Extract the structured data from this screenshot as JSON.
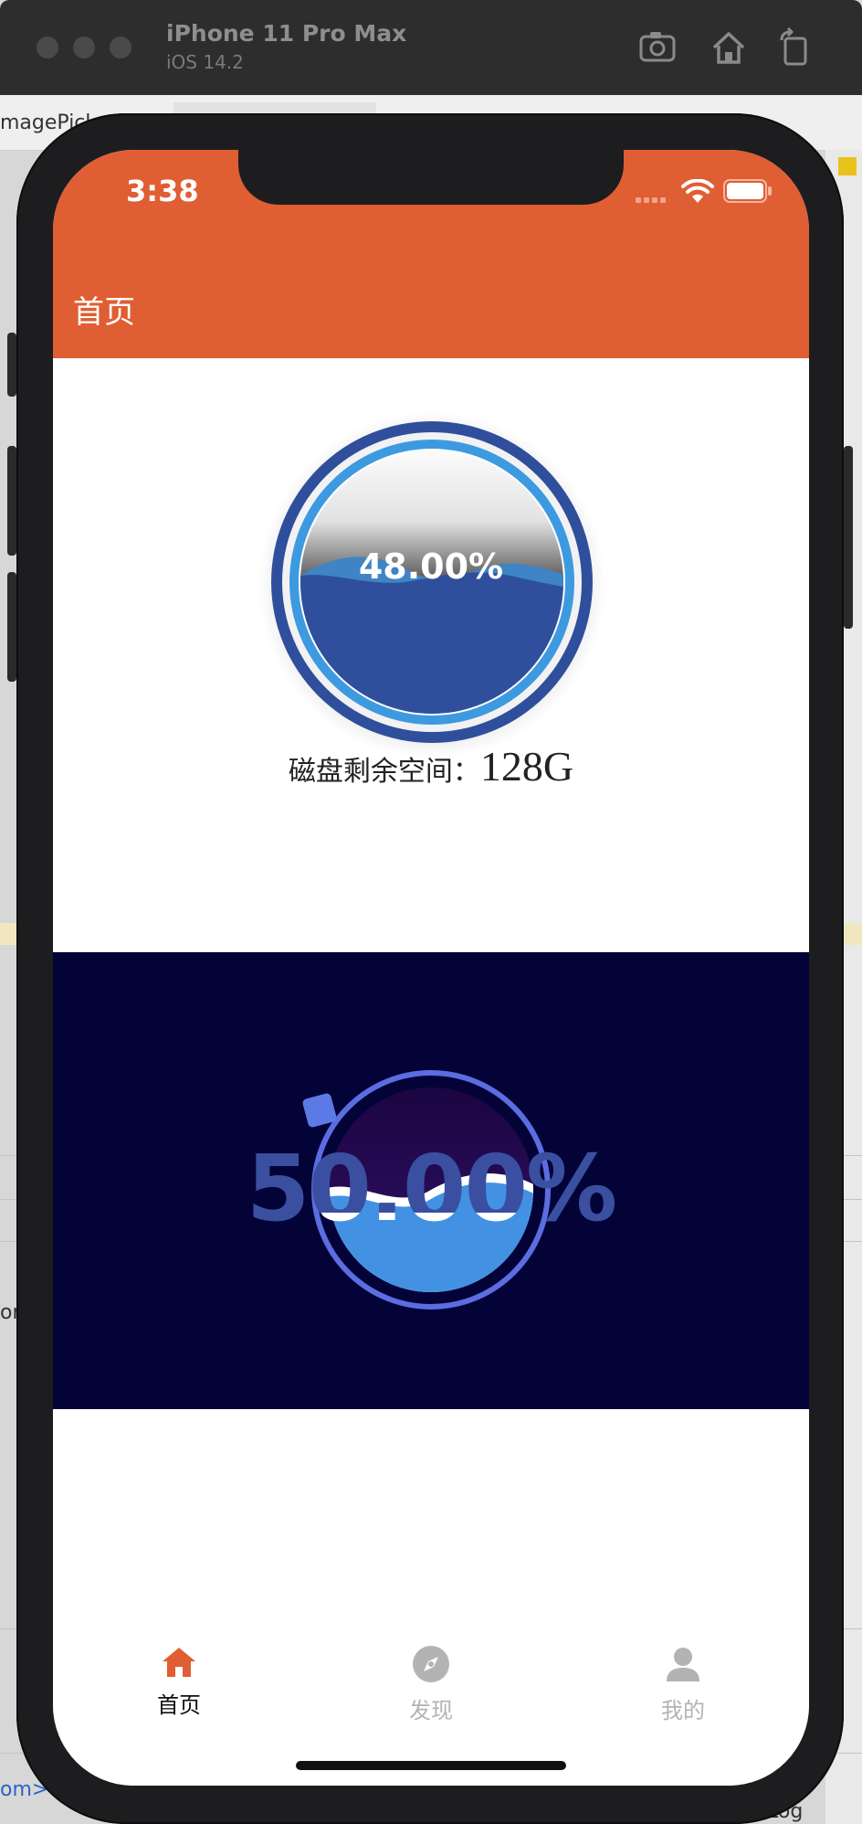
{
  "simulator": {
    "title": "iPhone 11 Pro Max",
    "subtitle": "iOS 14.2",
    "buttons": [
      "screenshot-icon",
      "home-icon",
      "rotate-icon"
    ]
  },
  "background": {
    "tab_text": "magePick",
    "left_text": "or",
    "bottom_left": "om>",
    "bottom_right": "Log"
  },
  "status_bar": {
    "time": "3:38"
  },
  "navbar": {
    "title": "首页"
  },
  "disk_gauge": {
    "percent_text": "48.00%",
    "fill_level": 0.48,
    "label": "磁盘剩余空间：",
    "value": "128G"
  },
  "progress_gauge": {
    "percent_text": "50.00%",
    "fill_level": 0.5
  },
  "tabbar": {
    "items": [
      {
        "label": "首页",
        "icon": "home-icon",
        "active": true
      },
      {
        "label": "发现",
        "icon": "compass-icon",
        "active": false
      },
      {
        "label": "我的",
        "icon": "person-icon",
        "active": false
      }
    ]
  },
  "colors": {
    "accent": "#e05e33",
    "gauge_blue": "#2f4f9c",
    "gauge_ring": "#3d9ae0",
    "dark_bg": "#040338",
    "tab_inactive": "#b3b3b3"
  }
}
